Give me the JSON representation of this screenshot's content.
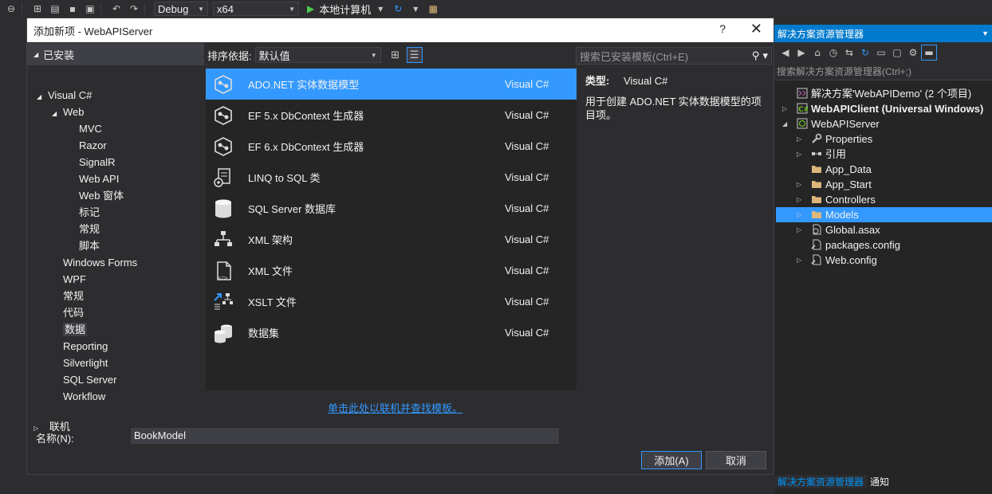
{
  "toolbar": {
    "config": "Debug",
    "platform": "x64",
    "run_label": "本地计算机"
  },
  "dialog": {
    "title": "添加新项 - WebAPIServer",
    "help": "?",
    "close": "✕",
    "installed_label": "已安装",
    "online_label": "联机",
    "tree": [
      {
        "label": "Visual C#",
        "indent": 0,
        "expander": "◢"
      },
      {
        "label": "Web",
        "indent": 1,
        "expander": "◢"
      },
      {
        "label": "MVC",
        "indent": 2,
        "expander": ""
      },
      {
        "label": "Razor",
        "indent": 2,
        "expander": ""
      },
      {
        "label": "SignalR",
        "indent": 2,
        "expander": ""
      },
      {
        "label": "Web API",
        "indent": 2,
        "expander": ""
      },
      {
        "label": "Web 窗体",
        "indent": 2,
        "expander": ""
      },
      {
        "label": "标记",
        "indent": 2,
        "expander": ""
      },
      {
        "label": "常规",
        "indent": 2,
        "expander": ""
      },
      {
        "label": "脚本",
        "indent": 2,
        "expander": ""
      },
      {
        "label": "Windows Forms",
        "indent": 1,
        "expander": ""
      },
      {
        "label": "WPF",
        "indent": 1,
        "expander": ""
      },
      {
        "label": "常规",
        "indent": 1,
        "expander": ""
      },
      {
        "label": "代码",
        "indent": 1,
        "expander": ""
      },
      {
        "label": "数据",
        "indent": 1,
        "expander": "",
        "selected": true
      },
      {
        "label": "Reporting",
        "indent": 1,
        "expander": ""
      },
      {
        "label": "Silverlight",
        "indent": 1,
        "expander": ""
      },
      {
        "label": "SQL Server",
        "indent": 1,
        "expander": ""
      },
      {
        "label": "Workflow",
        "indent": 1,
        "expander": ""
      }
    ],
    "sort_label": "排序依据:",
    "sort_value": "默认值",
    "search_placeholder": "搜索已安装模板(Ctrl+E)",
    "templates": [
      {
        "name": "ADO.NET 实体数据模型",
        "lang": "Visual C#",
        "icon": "entity-model-icon",
        "selected": true
      },
      {
        "name": "EF 5.x DbContext 生成器",
        "lang": "Visual C#",
        "icon": "dbcontext-generator-icon"
      },
      {
        "name": "EF 6.x DbContext 生成器",
        "lang": "Visual C#",
        "icon": "dbcontext-generator-icon"
      },
      {
        "name": "LINQ to SQL 类",
        "lang": "Visual C#",
        "icon": "linq-to-sql-icon"
      },
      {
        "name": "SQL Server 数据库",
        "lang": "Visual C#",
        "icon": "database-icon"
      },
      {
        "name": "XML 架构",
        "lang": "Visual C#",
        "icon": "xml-schema-icon"
      },
      {
        "name": "XML 文件",
        "lang": "Visual C#",
        "icon": "xml-file-icon"
      },
      {
        "name": "XSLT 文件",
        "lang": "Visual C#",
        "icon": "xslt-file-icon"
      },
      {
        "name": "数据集",
        "lang": "Visual C#",
        "icon": "dataset-icon"
      }
    ],
    "detail_type_key": "类型:",
    "detail_type_value": "Visual C#",
    "detail_desc": "用于创建 ADO.NET 实体数据模型的项目项。",
    "online_link": "单击此处以联机并查找模板。",
    "name_label": "名称(N):",
    "name_value": "BookModel",
    "add_button": "添加(A)",
    "cancel_button": "取消"
  },
  "solution_explorer": {
    "title": "解决方案资源管理器",
    "search_placeholder": "搜索解决方案资源管理器(Ctrl+;)",
    "items": [
      {
        "label": "解决方案'WebAPIDemo' (2 个项目)",
        "depth": 0,
        "expander": "",
        "icon": "solution-icon"
      },
      {
        "label": "WebAPIClient (Universal Windows)",
        "depth": 0,
        "expander": "▷",
        "icon": "csharp-project-icon",
        "bold": true
      },
      {
        "label": "WebAPIServer",
        "depth": 0,
        "expander": "◢",
        "icon": "web-project-icon"
      },
      {
        "label": "Properties",
        "depth": 1,
        "expander": "▷",
        "icon": "wrench-icon"
      },
      {
        "label": "引用",
        "depth": 1,
        "expander": "▷",
        "icon": "references-icon"
      },
      {
        "label": "App_Data",
        "depth": 1,
        "expander": "",
        "icon": "folder-icon"
      },
      {
        "label": "App_Start",
        "depth": 1,
        "expander": "▷",
        "icon": "folder-icon"
      },
      {
        "label": "Controllers",
        "depth": 1,
        "expander": "▷",
        "icon": "folder-icon"
      },
      {
        "label": "Models",
        "depth": 1,
        "expander": "▷",
        "icon": "folder-icon",
        "selected": true
      },
      {
        "label": "Global.asax",
        "depth": 1,
        "expander": "▷",
        "icon": "global-asax-icon"
      },
      {
        "label": "packages.config",
        "depth": 1,
        "expander": "",
        "icon": "config-file-icon"
      },
      {
        "label": "Web.config",
        "depth": 1,
        "expander": "▷",
        "icon": "config-file-icon"
      }
    ],
    "tab_solution": "解决方案资源管理器",
    "tab_notifications": "通知"
  },
  "colors": {
    "accent": "#3399ff",
    "titlebar_blue": "#007acc",
    "background": "#2d2d30",
    "folder": "#dcb67a"
  }
}
